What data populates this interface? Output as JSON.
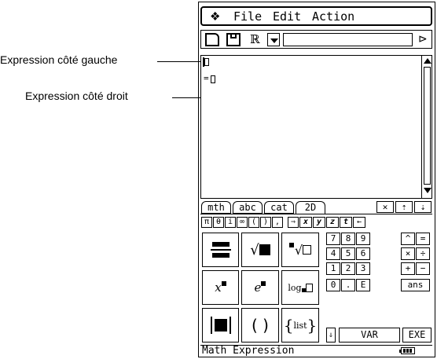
{
  "callouts": {
    "left": "Expression côté gauche",
    "right": "Expression côté droit"
  },
  "menu": {
    "arrow": "❖",
    "items": [
      "File",
      "Edit",
      "Action"
    ]
  },
  "toolbar": {
    "icons": [
      "new-file-icon",
      "save-icon",
      "real-mode-icon",
      "dropdown-icon",
      "scroll-right-icon"
    ],
    "real_label": "ℝ",
    "more_label": "⊳"
  },
  "workarea": {
    "equals": "="
  },
  "tabs": [
    "mth",
    "abc",
    "cat",
    "2D"
  ],
  "tab_icons": [
    "clear-icon",
    "up-icon",
    "enter-icon"
  ],
  "symbols": [
    "π",
    "θ",
    "i",
    "∞",
    "(",
    ")",
    ",",
    "⇒",
    "x",
    "y",
    "z",
    "t",
    "←"
  ],
  "template_keys": [
    [
      "fraction-template-icon",
      "sqrt-template-icon",
      "nth-root-template-icon"
    ],
    [
      "power-template-icon",
      "exp-template-icon",
      "log-template-icon"
    ],
    [
      "abs-template-icon",
      "paren-template-icon",
      "list-template-icon"
    ]
  ],
  "template_labels": {
    "power": "x",
    "exp": "e",
    "log": "log",
    "paren": "( )",
    "list": "list"
  },
  "numpad": [
    [
      "7",
      "8",
      "9",
      "^",
      "="
    ],
    [
      "4",
      "5",
      "6",
      "×",
      "÷"
    ],
    [
      "1",
      "2",
      "3",
      "+",
      "−"
    ],
    [
      "0",
      ".",
      "E",
      "ans"
    ]
  ],
  "bottom_keys": {
    "toggle": "⇓",
    "var": "VAR",
    "exe": "EXE"
  },
  "status": {
    "text": "Math Expression"
  },
  "colors": {
    "text": "#000000",
    "background": "#ffffff"
  }
}
